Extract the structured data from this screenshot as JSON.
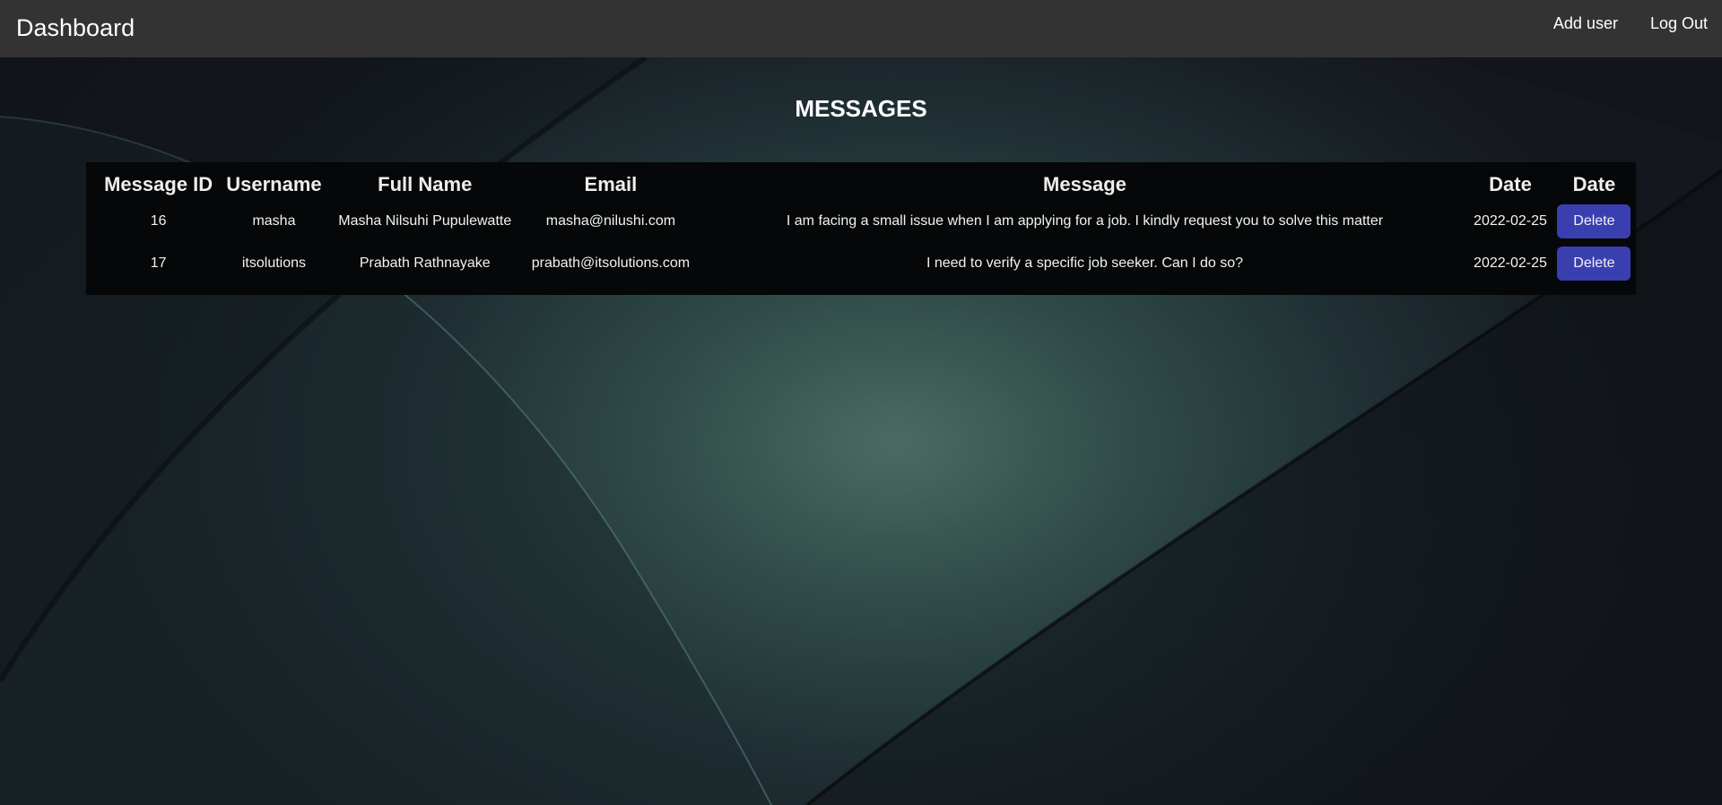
{
  "navbar": {
    "brand": "Dashboard",
    "links": [
      "Add user",
      "Log Out"
    ]
  },
  "page_title": "MESSAGES",
  "table": {
    "headers": [
      "Message ID",
      "Username",
      "Full Name",
      "Email",
      "Message",
      "Date",
      "Date"
    ],
    "rows": [
      {
        "id": "16",
        "username": "masha",
        "full_name": "Masha Nilsuhi Pupulewatte",
        "email": "masha@nilushi.com",
        "message": "I am facing a small issue when I am applying for a job. I kindly request you to solve this matter",
        "date": "2022-02-25",
        "action": "Delete"
      },
      {
        "id": "17",
        "username": "itsolutions",
        "full_name": "Prabath Rathnayake",
        "email": "prabath@itsolutions.com",
        "message": "I need to verify a specific job seeker. Can I do so?",
        "date": "2022-02-25",
        "action": "Delete"
      }
    ]
  },
  "colors": {
    "navbar": "#333333",
    "table_bg": "#050708",
    "delete_button": "#3a3fb0",
    "background": "#2f4b48"
  }
}
